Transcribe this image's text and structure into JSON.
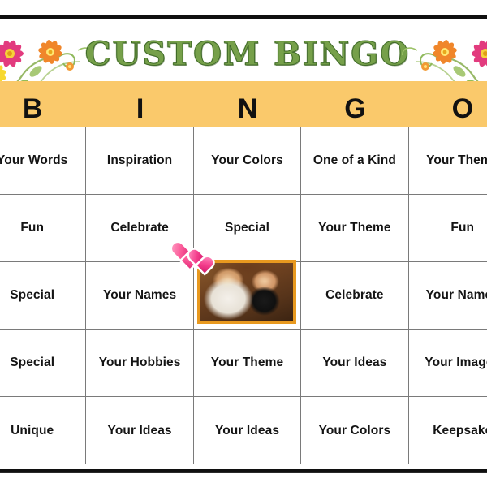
{
  "card": {
    "title": "CUSTOM BINGO",
    "header_letters": [
      "B",
      "I",
      "N",
      "G",
      "O"
    ],
    "colors": {
      "header_band": "#FAC96B",
      "title_green": "#76A04A",
      "grid_line": "#7A7A7A",
      "photo_border": "#E8991F",
      "heart_pink": "#F43F8D",
      "rule_black": "#101010"
    },
    "grid": {
      "rows": [
        [
          "Your Words",
          "Inspiration",
          "Your Colors",
          "One of a Kind",
          "Your Theme"
        ],
        [
          "Fun",
          "Celebrate",
          "Special",
          "Your Theme",
          "Fun"
        ],
        [
          "Special",
          "Your Names",
          "",
          "Celebrate",
          "Your Names"
        ],
        [
          "Special",
          "Your Hobbies",
          "Your Theme",
          "Your Ideas",
          "Your Images"
        ],
        [
          "Unique",
          "Your Ideas",
          "Your Ideas",
          "Your Colors",
          "Keepsake"
        ]
      ]
    },
    "free_space": {
      "type": "photo",
      "description": "Photo of an older couple, man in white shirt with glasses and woman in black top with glasses, gold framed"
    },
    "sticker": {
      "type": "hearts",
      "count": 2,
      "description": "Two overlapping pink hearts sticker at top-left of center photo"
    },
    "decoration": {
      "type": "floral-corners",
      "count": 2,
      "description": "Pink, orange and yellow flowers with green foliage swirls in the top-left and top-right corners of the title band"
    }
  }
}
